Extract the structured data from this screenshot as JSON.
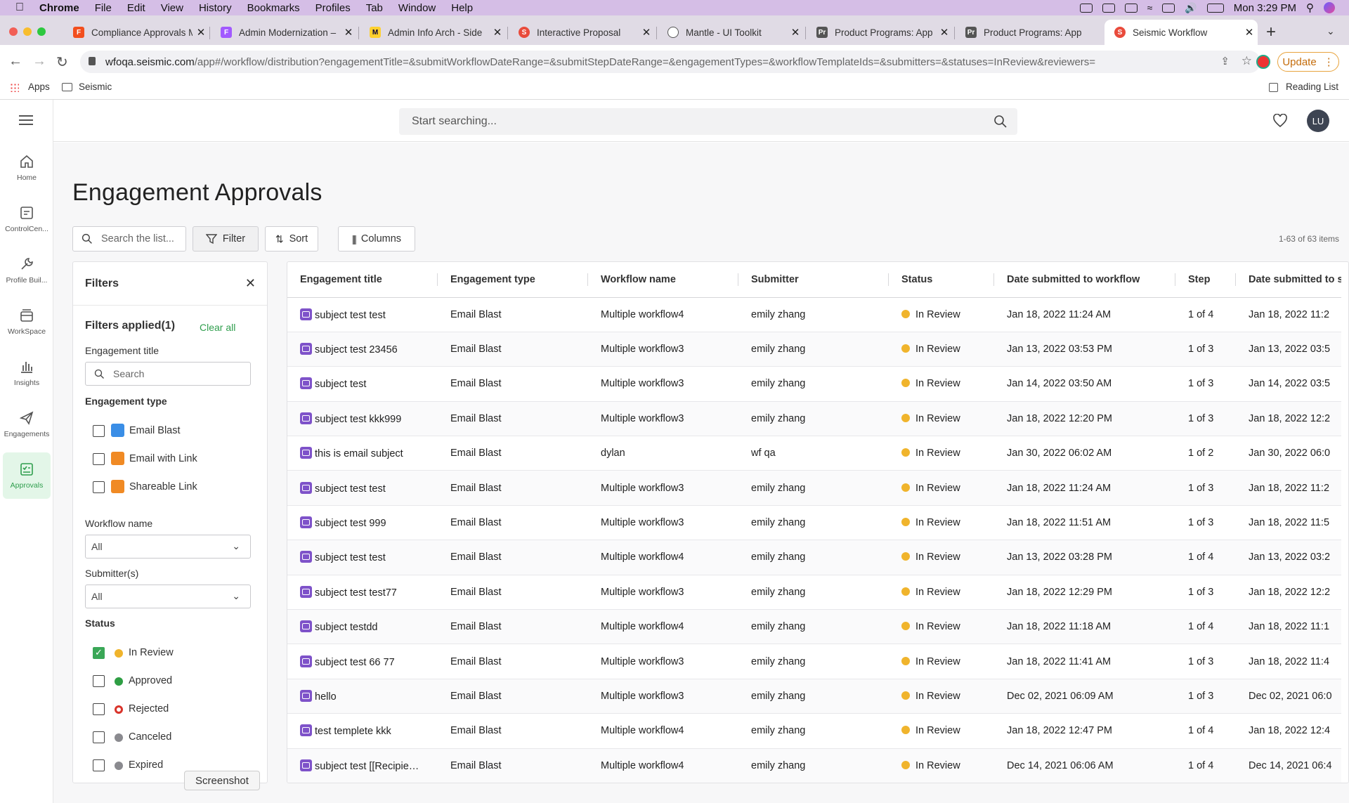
{
  "menubar": {
    "app_name": "Chrome",
    "items": [
      "File",
      "Edit",
      "View",
      "History",
      "Bookmarks",
      "Profiles",
      "Tab",
      "Window",
      "Help"
    ],
    "clock": "Mon 3:29 PM"
  },
  "tabs": [
    {
      "title": "Compliance Approvals M",
      "icon": "figma-icon",
      "active": false
    },
    {
      "title": "Admin Modernization –",
      "icon": "figma-icon",
      "active": false
    },
    {
      "title": "Admin Info Arch - Side",
      "icon": "miro-icon",
      "active": false
    },
    {
      "title": "Interactive Proposal",
      "icon": "seismic-icon",
      "active": false
    },
    {
      "title": "Mantle - UI Toolkit",
      "icon": "globe-icon",
      "active": false
    },
    {
      "title": "Product Programs: App",
      "icon": "pr-icon",
      "active": false
    },
    {
      "title": "Product Programs: App",
      "icon": "pr-icon",
      "active": false
    },
    {
      "title": "Seismic Workflow",
      "icon": "seismic-icon",
      "active": true
    }
  ],
  "toolbar": {
    "url_host": "wfoqa.seismic.com",
    "url_path": "/app#/workflow/distribution?engagementTitle=&submitWorkflowDateRange=&submitStepDateRange=&engagementTypes=&workflowTemplateIds=&submitters=&statuses=InReview&reviewers=",
    "update_label": "Update"
  },
  "bookmarks": {
    "apps": "Apps",
    "seismic": "Seismic",
    "reading_list": "Reading List"
  },
  "leftnav": [
    {
      "label": "Home",
      "icon": "home-icon",
      "active": false
    },
    {
      "label": "ControlCen...",
      "icon": "control-center-icon",
      "active": false
    },
    {
      "label": "Profile Buil...",
      "icon": "wrench-icon",
      "active": false
    },
    {
      "label": "WorkSpace",
      "icon": "workspace-icon",
      "active": false
    },
    {
      "label": "Insights",
      "icon": "bar-chart-icon",
      "active": false
    },
    {
      "label": "Engagements",
      "icon": "paper-plane-icon",
      "active": false
    },
    {
      "label": "Approvals",
      "icon": "approvals-icon",
      "active": true
    }
  ],
  "topbar": {
    "search_placeholder": "Start searching...",
    "avatar": "LU"
  },
  "page": {
    "title": "Engagement Approvals",
    "list_search_placeholder": "Search the list...",
    "filter_label": "Filter",
    "sort_label": "Sort",
    "columns_label": "Columns",
    "count": "1-63 of 63 items"
  },
  "filters": {
    "title": "Filters",
    "applied": "Filters applied(1)",
    "clear_all": "Clear all",
    "engagement_title_label": "Engagement title",
    "engagement_title_placeholder": "Search",
    "engagement_type_label": "Engagement type",
    "engagement_types": [
      {
        "label": "Email Blast",
        "checked": false
      },
      {
        "label": "Email with Link",
        "checked": false
      },
      {
        "label": "Shareable Link",
        "checked": false
      }
    ],
    "workflow_name_label": "Workflow name",
    "workflow_name_value": "All",
    "submitters_label": "Submitter(s)",
    "submitters_value": "All",
    "status_label": "Status",
    "statuses": [
      {
        "label": "In Review",
        "checked": true,
        "color": "#f0b42c"
      },
      {
        "label": "Approved",
        "checked": false,
        "color": "#2e9e44"
      },
      {
        "label": "Rejected",
        "checked": false,
        "color": "#d9342b"
      },
      {
        "label": "Canceled",
        "checked": false,
        "color": "#8a8a8f"
      },
      {
        "label": "Expired",
        "checked": false,
        "color": "#8a8a8f"
      }
    ]
  },
  "table": {
    "columns": [
      "Engagement title",
      "Engagement type",
      "Workflow name",
      "Submitter",
      "Status",
      "Date submitted to workflow",
      "Step",
      "Date submitted to step"
    ],
    "rows": [
      [
        "subject test test",
        "Email Blast",
        "Multiple workflow4",
        "emily zhang",
        "In Review",
        "Jan 18, 2022 11:24 AM",
        "1 of 4",
        "Jan 18, 2022 11:2"
      ],
      [
        "subject test 23456",
        "Email Blast",
        "Multiple workflow3",
        "emily zhang",
        "In Review",
        "Jan 13, 2022 03:53 PM",
        "1 of 3",
        "Jan 13, 2022 03:5"
      ],
      [
        "subject test",
        "Email Blast",
        "Multiple workflow3",
        "emily zhang",
        "In Review",
        "Jan 14, 2022 03:50 AM",
        "1 of 3",
        "Jan 14, 2022 03:5"
      ],
      [
        "subject test kkk999",
        "Email Blast",
        "Multiple workflow3",
        "emily zhang",
        "In Review",
        "Jan 18, 2022 12:20 PM",
        "1 of 3",
        "Jan 18, 2022 12:2"
      ],
      [
        "this is email subject",
        "Email Blast",
        "dylan",
        "wf qa",
        "In Review",
        "Jan 30, 2022 06:02 AM",
        "1 of 2",
        "Jan 30, 2022 06:0"
      ],
      [
        "subject test test",
        "Email Blast",
        "Multiple workflow3",
        "emily zhang",
        "In Review",
        "Jan 18, 2022 11:24 AM",
        "1 of 3",
        "Jan 18, 2022 11:2"
      ],
      [
        "subject test 999",
        "Email Blast",
        "Multiple workflow3",
        "emily zhang",
        "In Review",
        "Jan 18, 2022 11:51 AM",
        "1 of 3",
        "Jan 18, 2022 11:5"
      ],
      [
        "subject test test",
        "Email Blast",
        "Multiple workflow4",
        "emily zhang",
        "In Review",
        "Jan 13, 2022 03:28 PM",
        "1 of 4",
        "Jan 13, 2022 03:2"
      ],
      [
        "subject test test77",
        "Email Blast",
        "Multiple workflow3",
        "emily zhang",
        "In Review",
        "Jan 18, 2022 12:29 PM",
        "1 of 3",
        "Jan 18, 2022 12:2"
      ],
      [
        "subject testdd",
        "Email Blast",
        "Multiple workflow4",
        "emily zhang",
        "In Review",
        "Jan 18, 2022 11:18 AM",
        "1 of 4",
        "Jan 18, 2022 11:1"
      ],
      [
        "subject test 66 77",
        "Email Blast",
        "Multiple workflow3",
        "emily zhang",
        "In Review",
        "Jan 18, 2022 11:41 AM",
        "1 of 3",
        "Jan 18, 2022 11:4"
      ],
      [
        "hello",
        "Email Blast",
        "Multiple workflow3",
        "emily zhang",
        "In Review",
        "Dec 02, 2021 06:09 AM",
        "1 of 3",
        "Dec 02, 2021 06:0"
      ],
      [
        "test templete kkk",
        "Email Blast",
        "Multiple workflow4",
        "emily zhang",
        "In Review",
        "Jan 18, 2022 12:47 PM",
        "1 of 4",
        "Jan 18, 2022 12:4"
      ],
      [
        "subject test [[Recipie…",
        "Email Blast",
        "Multiple workflow4",
        "emily zhang",
        "In Review",
        "Dec 14, 2021 06:06 AM",
        "1 of 4",
        "Dec 14, 2021 06:4"
      ]
    ]
  },
  "tooltip": "Screenshot"
}
